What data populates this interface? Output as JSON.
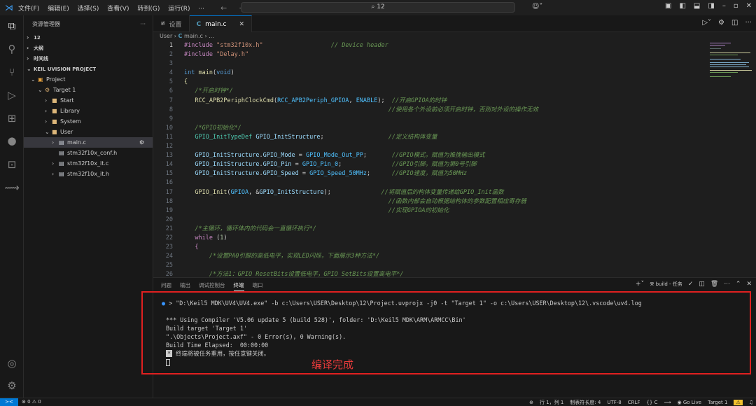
{
  "titlebar": {
    "menu": [
      "文件(F)",
      "编辑(E)",
      "选择(S)",
      "查看(V)",
      "转到(G)",
      "运行(R)",
      "···"
    ],
    "search": "12"
  },
  "sidebar": {
    "title": "资源管理器",
    "sections": [
      "12",
      "大纲",
      "时间线",
      "KEIL UVISION PROJECT"
    ],
    "tree": [
      {
        "label": "Project",
        "level": 1
      },
      {
        "label": "Target 1",
        "level": 2
      },
      {
        "label": "Start",
        "level": 3
      },
      {
        "label": "Library",
        "level": 3
      },
      {
        "label": "System",
        "level": 3
      },
      {
        "label": "User",
        "level": 3
      },
      {
        "label": "main.c",
        "level": 4
      },
      {
        "label": "stm32f10x_conf.h",
        "level": 4
      },
      {
        "label": "stm32f10x_it.c",
        "level": 4
      },
      {
        "label": "stm32f10x_it.h",
        "level": 4
      }
    ]
  },
  "tabs": {
    "settings": "设置",
    "main": "main.c",
    "main_icon": "C"
  },
  "breadcrumb": {
    "folder": "User",
    "file": "main.c",
    "tail": "..."
  },
  "code": {
    "lines": [
      {
        "n": "1",
        "h": "<span class='k'>#include</span> <span class='s'>\"stm32f10x.h\"</span>                   <span class='c'>// Device header</span>"
      },
      {
        "n": "2",
        "h": "<span class='k'>#include</span> <span class='s'>\"Delay.h\"</span>"
      },
      {
        "n": "3",
        "h": ""
      },
      {
        "n": "4",
        "h": "<span class='b'>int</span> <span class='f'>main</span>(<span class='b'>void</span>)"
      },
      {
        "n": "5",
        "h": "<span class='f'>{</span>"
      },
      {
        "n": "6",
        "h": "   <span class='c'>/*开启时钟*/</span>"
      },
      {
        "n": "7",
        "h": "   <span class='f'>RCC_APB2PeriphClockCmd</span>(<span class='m'>RCC_APB2Periph_GPIOA</span>, <span class='m'>ENABLE</span>);  <span class='c'>//开启GPIOA的时钟</span>"
      },
      {
        "n": "8",
        "h": "                                                         <span class='c'>//使用各个外设前必须开启时钟，否则对外设的操作无效</span>"
      },
      {
        "n": "9",
        "h": ""
      },
      {
        "n": "10",
        "h": "   <span class='c'>/*GPIO初始化*/</span>"
      },
      {
        "n": "11",
        "h": "   <span class='t'>GPIO_InitTypeDef</span> <span class='v'>GPIO_InitStructure</span>;                  <span class='c'>//定义结构体变量</span>"
      },
      {
        "n": "12",
        "h": ""
      },
      {
        "n": "13",
        "h": "   <span class='v'>GPIO_InitStructure</span>.<span class='v'>GPIO_Mode</span> = <span class='m'>GPIO_Mode_Out_PP</span>;       <span class='c'>//GPIO模式，赋值为推挽输出模式</span>"
      },
      {
        "n": "14",
        "h": "   <span class='v'>GPIO_InitStructure</span>.<span class='v'>GPIO_Pin</span> = <span class='m'>GPIO_Pin_0</span>;              <span class='c'>//GPIO引脚，赋值为第0号引脚</span>"
      },
      {
        "n": "15",
        "h": "   <span class='v'>GPIO_InitStructure</span>.<span class='v'>GPIO_Speed</span> = <span class='m'>GPIO_Speed_50MHz</span>;      <span class='c'>//GPIO速度，赋值为50MHz</span>"
      },
      {
        "n": "16",
        "h": ""
      },
      {
        "n": "17",
        "h": "   <span class='f'>GPIO_Init</span>(<span class='m'>GPIOA</span>, &amp;<span class='v'>GPIO_InitStructure</span>);              <span class='c'>//将赋值后的构体变量传递给GPIO_Init函数</span>"
      },
      {
        "n": "18",
        "h": "                                                         <span class='c'>//函数内部会自动根据结构体的参数配置相应寄存器</span>"
      },
      {
        "n": "19",
        "h": "                                                         <span class='c'>//实现GPIOA的初始化</span>"
      },
      {
        "n": "20",
        "h": ""
      },
      {
        "n": "21",
        "h": "   <span class='c'>/*主循环，循环体内的代码会一直循环执行*/</span>"
      },
      {
        "n": "22",
        "h": "   <span class='k'>while</span> (<span class='n'>1</span>)"
      },
      {
        "n": "23",
        "h": "   <span class='k'>{</span>"
      },
      {
        "n": "24",
        "h": "       <span class='c'>/*设置PA0引脚的高低电平，实现LED闪烁，下面展示3种方法*/</span>"
      },
      {
        "n": "25",
        "h": ""
      },
      {
        "n": "26",
        "h": "       <span class='c'>/*方法1：GPIO_ResetBits设置低电平，GPIO_SetBits设置高电平*/</span>"
      }
    ]
  },
  "panel": {
    "tabs": [
      "问题",
      "输出",
      "调试控制台",
      "终端",
      "端口"
    ],
    "active_tab": "终端",
    "task": "build - 任务",
    "terminal": [
      "> \"D:\\Keil5 MDK\\UV4\\UV4.exe\" -b c:\\Users\\USER\\Desktop\\12\\Project.uvprojx -j0 -t \"Target 1\" -o c:\\Users\\USER\\Desktop\\12\\.vscode\\uv4.log",
      "",
      "*** Using Compiler 'V5.06 update 5 (build 528)', folder: 'D:\\Keil5 MDK\\ARM\\ARMCC\\Bin'",
      "Build target 'Target 1'",
      "\".\\Objects\\Project.axf\" - 0 Error(s), 0 Warning(s).",
      "Build Time Elapsed:  00:00:00"
    ],
    "terminal_reuse": "终端将被任务重用，按任意键关闭。",
    "annotation": "编译完成"
  },
  "statusbar": {
    "problems": "⊗ 0 ⚠ 0",
    "position": "行 1，列 1",
    "tab_size": "制表符长度: 4",
    "encoding": "UTF-8",
    "eol": "CRLF",
    "lang": "{} C",
    "golive": "Go Live",
    "target": "Target 1"
  }
}
